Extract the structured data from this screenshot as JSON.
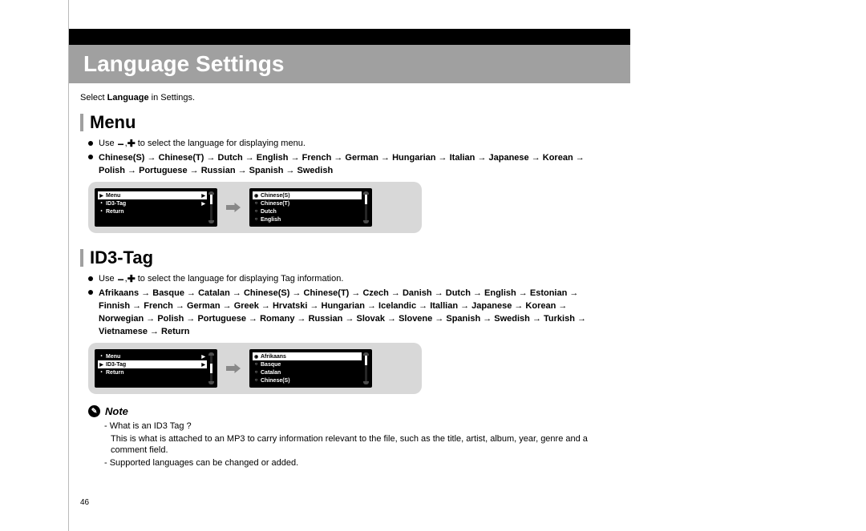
{
  "title": "Language Settings",
  "intro_pre": "Select ",
  "intro_strong": "Language",
  "intro_post": " in Settings.",
  "page_number": "46",
  "menu": {
    "heading": "Menu",
    "instr_pre": "Use ",
    "instr_post": " to select the language for displaying menu.",
    "chain": "Chinese(S) → Chinese(T) → Dutch → English → French → German → Hungarian → Italian → Japanese → Korean → Polish → Portuguese → Russian → Spanish → Swedish",
    "left_screen": {
      "r1": "Menu",
      "r2": "ID3-Tag",
      "r3": "Return"
    },
    "right_screen": {
      "r1": "Chinese(S)",
      "r2": "Chinese(T)",
      "r3": "Dutch",
      "r4": "English"
    }
  },
  "id3": {
    "heading": "ID3-Tag",
    "instr_pre": "Use ",
    "instr_post": " to select the language for displaying Tag information.",
    "chain": "Afrikaans → Basque → Catalan → Chinese(S) → Chinese(T) → Czech → Danish → Dutch → English → Estonian → Finnish → French → German → Greek → Hrvatski → Hungarian → Icelandic → Itallian → Japanese → Korean → Norwegian → Polish → Portuguese → Romany → Russian → Slovak → Slovene → Spanish → Swedish → Turkish → Vietnamese → Return",
    "left_screen": {
      "r1": "Menu",
      "r2": "ID3-Tag",
      "r3": "Return"
    },
    "right_screen": {
      "r1": "Afrikaans",
      "r2": "Basque",
      "r3": "Catalan",
      "r4": "Chinese(S)"
    }
  },
  "note": {
    "label": "Note",
    "l1": "- What is an ID3 Tag ?",
    "l2": "This is what is attached to an MP3 to carry information relevant to the file, such as the title, artist, album, year, genre and a comment field.",
    "l3": "- Supported languages can be changed or added."
  }
}
